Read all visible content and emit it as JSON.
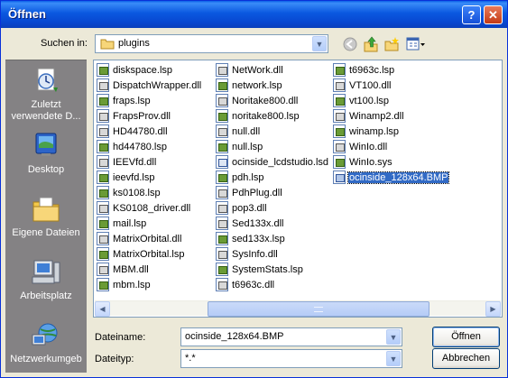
{
  "window": {
    "title": "Öffnen"
  },
  "titlebar": {
    "help_label": "?",
    "close_label": "✕"
  },
  "look_in": {
    "label": "Suchen in:",
    "value": "plugins"
  },
  "toolbar": {
    "icons": [
      "back-icon",
      "up-folder-icon",
      "new-folder-icon",
      "view-menu-icon"
    ]
  },
  "places": [
    {
      "label": "Zuletzt verwendete D...",
      "icon": "recent-documents-icon"
    },
    {
      "label": "Desktop",
      "icon": "desktop-icon"
    },
    {
      "label": "Eigene Dateien",
      "icon": "my-documents-icon"
    },
    {
      "label": "Arbeitsplatz",
      "icon": "my-computer-icon"
    },
    {
      "label": "Netzwerkumgeb",
      "icon": "network-icon"
    }
  ],
  "files": {
    "columns": [
      [
        {
          "name": "diskspace.lsp",
          "type": "lsp"
        },
        {
          "name": "DispatchWrapper.dll",
          "type": "dll"
        },
        {
          "name": "fraps.lsp",
          "type": "lsp"
        },
        {
          "name": "FrapsProv.dll",
          "type": "dll"
        },
        {
          "name": "HD44780.dll",
          "type": "dll"
        },
        {
          "name": "hd44780.lsp",
          "type": "lsp"
        },
        {
          "name": "IEEVfd.dll",
          "type": "dll"
        },
        {
          "name": "ieevfd.lsp",
          "type": "lsp"
        },
        {
          "name": "ks0108.lsp",
          "type": "lsp"
        },
        {
          "name": "KS0108_driver.dll",
          "type": "dll"
        },
        {
          "name": "mail.lsp",
          "type": "lsp"
        },
        {
          "name": "MatrixOrbital.dll",
          "type": "dll"
        },
        {
          "name": "MatrixOrbital.lsp",
          "type": "lsp"
        },
        {
          "name": "MBM.dll",
          "type": "dll"
        },
        {
          "name": "mbm.lsp",
          "type": "lsp"
        }
      ],
      [
        {
          "name": "NetWork.dll",
          "type": "dll"
        },
        {
          "name": "network.lsp",
          "type": "lsp"
        },
        {
          "name": "Noritake800.dll",
          "type": "dll"
        },
        {
          "name": "noritake800.lsp",
          "type": "lsp"
        },
        {
          "name": "null.dll",
          "type": "dll"
        },
        {
          "name": "null.lsp",
          "type": "lsp"
        },
        {
          "name": "ocinside_lcdstudio.lsd",
          "type": "lsd"
        },
        {
          "name": "pdh.lsp",
          "type": "lsp"
        },
        {
          "name": "PdhPlug.dll",
          "type": "dll"
        },
        {
          "name": "pop3.dll",
          "type": "dll"
        },
        {
          "name": "Sed133x.dll",
          "type": "dll"
        },
        {
          "name": "sed133x.lsp",
          "type": "lsp"
        },
        {
          "name": "SysInfo.dll",
          "type": "dll"
        },
        {
          "name": "SystemStats.lsp",
          "type": "lsp"
        },
        {
          "name": "t6963c.dll",
          "type": "dll"
        }
      ],
      [
        {
          "name": "t6963c.lsp",
          "type": "lsp"
        },
        {
          "name": "VT100.dll",
          "type": "dll"
        },
        {
          "name": "vt100.lsp",
          "type": "lsp"
        },
        {
          "name": "Winamp2.dll",
          "type": "dll"
        },
        {
          "name": "winamp.lsp",
          "type": "lsp"
        },
        {
          "name": "WinIo.dll",
          "type": "dll"
        },
        {
          "name": "WinIo.sys",
          "type": "sys"
        },
        {
          "name": "ocinside_128x64.BMP",
          "type": "bmp",
          "selected": true
        }
      ]
    ]
  },
  "filename": {
    "label": "Dateiname:",
    "value": "ocinside_128x64.BMP"
  },
  "filetype": {
    "label": "Dateityp:",
    "value": "*.*"
  },
  "buttons": {
    "open_label": "Öffnen",
    "cancel_label": "Abbrechen"
  },
  "colors": {
    "titlebar": "#0a58e0",
    "selection": "#316ac5",
    "places_bar": "#848284",
    "dialog_bg": "#ece9d8"
  }
}
